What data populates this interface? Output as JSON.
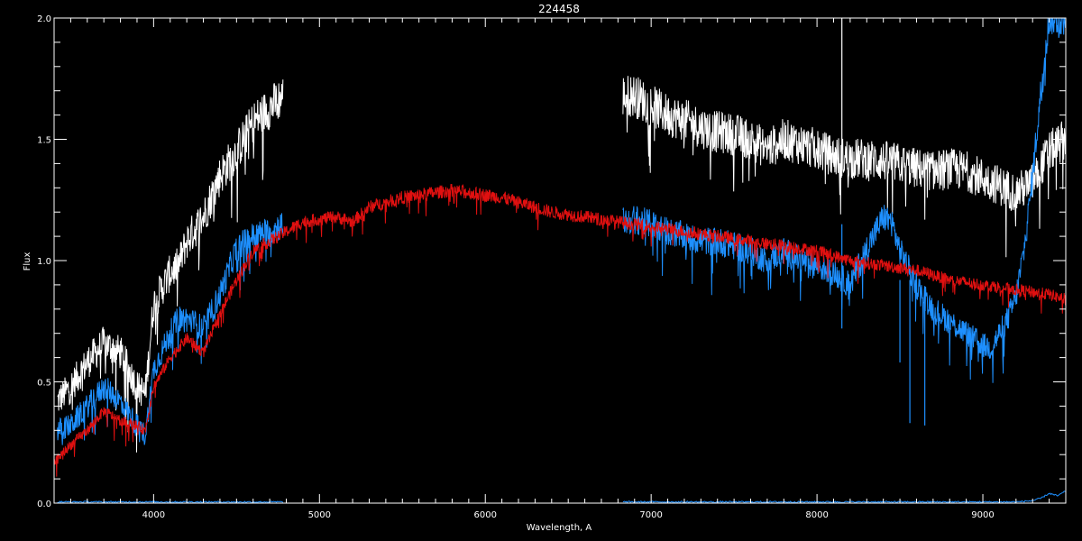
{
  "chart_data": {
    "type": "line",
    "title": "224458",
    "xlabel": "Wavelength, A",
    "ylabel": "Flux",
    "xlim": [
      3400,
      9500
    ],
    "ylim": [
      0,
      2.0
    ],
    "x_ticks": [
      4000,
      5000,
      6000,
      7000,
      8000,
      9000
    ],
    "x_tick_labels": [
      "4000",
      "5000",
      "6000",
      "7000",
      "8000",
      "9000"
    ],
    "y_ticks": [
      0,
      0.5,
      1.0,
      1.5,
      2.0
    ],
    "y_tick_labels": [
      "0.0",
      "0.5",
      "1.0",
      "1.5",
      "2.0"
    ],
    "grid": false,
    "colors": {
      "background": "#000000",
      "axes": "#ffffff",
      "white_spectrum": "#ffffff",
      "blue_spectrum": "#1e90ff",
      "red_model": "#e01010"
    },
    "series": [
      {
        "color": "#ffffff",
        "noise": 0.06,
        "segments": [
          {
            "x": [
              3420,
              3500,
              3600,
              3700,
              3800,
              3900,
              3950,
              4000,
              4100,
              4150,
              4200,
              4300,
              4400,
              4500,
              4600,
              4700,
              4780
            ],
            "y": [
              0.42,
              0.48,
              0.58,
              0.66,
              0.62,
              0.48,
              0.45,
              0.82,
              0.95,
              0.98,
              1.08,
              1.18,
              1.35,
              1.45,
              1.57,
              1.63,
              1.68
            ]
          },
          {
            "x": [
              6830,
              6900,
              7000,
              7100,
              7200,
              7300,
              7400,
              7500,
              7600,
              7700,
              7800,
              7900,
              8000,
              8100,
              8200,
              8300,
              8400,
              8500,
              8600,
              8700,
              8800,
              8900,
              9000,
              9100,
              9200,
              9300,
              9400,
              9500
            ],
            "y": [
              1.68,
              1.68,
              1.64,
              1.6,
              1.58,
              1.55,
              1.53,
              1.52,
              1.5,
              1.46,
              1.5,
              1.48,
              1.46,
              1.43,
              1.42,
              1.42,
              1.41,
              1.4,
              1.38,
              1.37,
              1.38,
              1.37,
              1.34,
              1.31,
              1.28,
              1.32,
              1.45,
              1.5
            ]
          }
        ],
        "spikes": [
          {
            "x": 8150,
            "y0": 1.35,
            "y1": 2.0
          }
        ]
      },
      {
        "color": "#1e90ff",
        "noise": 0.045,
        "segments": [
          {
            "x": [
              3420,
              3500,
              3600,
              3700,
              3800,
              3900,
              3950,
              4000,
              4100,
              4150,
              4200,
              4300,
              4400,
              4500,
              4600,
              4700,
              4780
            ],
            "y": [
              0.3,
              0.32,
              0.4,
              0.48,
              0.42,
              0.32,
              0.28,
              0.55,
              0.7,
              0.76,
              0.76,
              0.72,
              0.86,
              1.05,
              1.1,
              1.12,
              1.15
            ]
          },
          {
            "x": [
              6830,
              6900,
              7000,
              7100,
              7200,
              7300,
              7400,
              7500,
              7600,
              7700,
              7800,
              7900,
              8000,
              8100,
              8200,
              8300,
              8400,
              8450,
              8500,
              8600,
              8700,
              8800,
              8900,
              9000,
              9050,
              9100,
              9150,
              9200,
              9250,
              9300,
              9350,
              9400,
              9450,
              9500
            ],
            "y": [
              1.16,
              1.17,
              1.15,
              1.12,
              1.1,
              1.08,
              1.08,
              1.06,
              1.04,
              1.0,
              1.04,
              1.0,
              0.98,
              0.95,
              0.9,
              1.05,
              1.18,
              1.16,
              1.04,
              0.9,
              0.8,
              0.75,
              0.7,
              0.65,
              0.64,
              0.7,
              0.76,
              0.85,
              1.05,
              1.35,
              1.7,
              2.0,
              2.0,
              2.0
            ]
          }
        ],
        "spikes": [
          {
            "x": 8150,
            "y0": 0.72,
            "y1": 1.15
          },
          {
            "x": 8500,
            "y0": 0.58,
            "y1": 0.92
          },
          {
            "x": 8560,
            "y0": 0.33,
            "y1": 0.92
          },
          {
            "x": 8650,
            "y0": 0.32,
            "y1": 0.86
          }
        ]
      },
      {
        "color": "#1e90ff",
        "noise": 0.003,
        "segments": [
          {
            "x": [
              3420,
              4780
            ],
            "y": [
              0.005,
              0.005
            ]
          },
          {
            "x": [
              6830,
              9200,
              9300,
              9350,
              9400,
              9450,
              9500
            ],
            "y": [
              0.005,
              0.005,
              0.01,
              0.02,
              0.04,
              0.03,
              0.05
            ]
          }
        ],
        "spikes": []
      },
      {
        "color": "#e01010",
        "noise": 0.02,
        "segments": [
          {
            "x": [
              3400,
              3500,
              3600,
              3700,
              3800,
              3900,
              3950,
              4000,
              4100,
              4200,
              4300,
              4400,
              4500,
              4600,
              4700,
              4800,
              4900,
              5000,
              5100,
              5200,
              5300,
              5400,
              5500,
              5600,
              5700,
              5800,
              5900,
              6000,
              6100,
              6200,
              6300,
              6400,
              6500,
              6600,
              6700,
              6800,
              7000,
              7200,
              7400,
              7600,
              7800,
              8000,
              8200,
              8400,
              8600,
              8800,
              9000,
              9200,
              9400,
              9500
            ],
            "y": [
              0.17,
              0.24,
              0.3,
              0.38,
              0.34,
              0.32,
              0.3,
              0.48,
              0.6,
              0.68,
              0.62,
              0.78,
              0.92,
              1.04,
              1.08,
              1.12,
              1.16,
              1.17,
              1.18,
              1.16,
              1.22,
              1.24,
              1.26,
              1.27,
              1.28,
              1.29,
              1.28,
              1.27,
              1.26,
              1.24,
              1.22,
              1.2,
              1.19,
              1.18,
              1.17,
              1.16,
              1.14,
              1.12,
              1.1,
              1.08,
              1.06,
              1.04,
              1.0,
              0.98,
              0.96,
              0.92,
              0.9,
              0.88,
              0.86,
              0.84
            ]
          }
        ],
        "spikes": []
      }
    ]
  }
}
